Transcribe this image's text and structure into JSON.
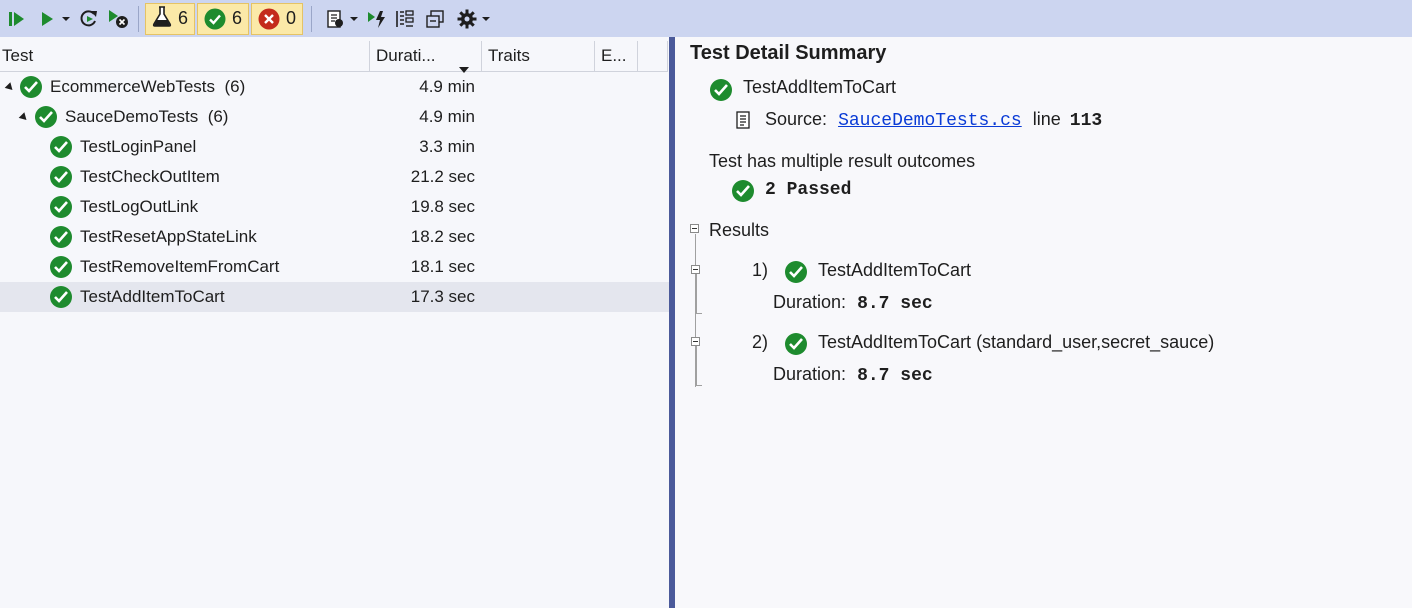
{
  "toolbar": {
    "counters": {
      "total": "6",
      "passed": "6",
      "failed": "0"
    },
    "icons": [
      "run-all-icon",
      "run-icon",
      "dropdown-icon",
      "repeat-last-run-icon",
      "cancel-run-icon",
      "flask-icon",
      "passed-icon",
      "failed-icon",
      "playlist-icon",
      "run-on-build-icon",
      "group-by-icon",
      "collapse-icon",
      "settings-icon"
    ]
  },
  "grid": {
    "columns": [
      "Test",
      "Durati...",
      "Traits",
      "E..."
    ],
    "rows": [
      {
        "name": "EcommerceWebTests",
        "count": "(6)",
        "duration": "4.9 min"
      },
      {
        "name": "SauceDemoTests",
        "count": "(6)",
        "duration": "4.9 min"
      },
      {
        "name": "TestLoginPanel",
        "count": "",
        "duration": "3.3 min"
      },
      {
        "name": "TestCheckOutItem",
        "count": "",
        "duration": "21.2 sec"
      },
      {
        "name": "TestLogOutLink",
        "count": "",
        "duration": "19.8 sec"
      },
      {
        "name": "TestResetAppStateLink",
        "count": "",
        "duration": "18.2 sec"
      },
      {
        "name": "TestRemoveItemFromCart",
        "count": "",
        "duration": "18.1 sec"
      },
      {
        "name": "TestAddItemToCart",
        "count": "",
        "duration": "17.3 sec"
      }
    ]
  },
  "detail": {
    "title": "Test Detail Summary",
    "test_name": "TestAddItemToCart",
    "source_label": "Source:",
    "source_file": "SauceDemoTests.cs",
    "line_label": "line",
    "line_number": "113",
    "outcomes_text": "Test has multiple result outcomes",
    "passed_summary": "2 Passed",
    "results_label": "Results",
    "results": [
      {
        "index": "1)",
        "name": "TestAddItemToCart",
        "duration_label": "Duration:",
        "duration": "8.7 sec"
      },
      {
        "index": "2)",
        "name": "TestAddItemToCart (standard_user,secret_sauce)",
        "duration_label": "Duration:",
        "duration": "8.7 sec"
      }
    ]
  },
  "colors": {
    "toolbar_bg": "#ccd5f0",
    "pass_green": "#1e8b2e",
    "fail_red": "#c42b1c",
    "counter_bg": "#fbe9a8",
    "selected_row": "#e4e6ee",
    "splitter": "#4b5a9a",
    "link": "#0a3bd6"
  }
}
